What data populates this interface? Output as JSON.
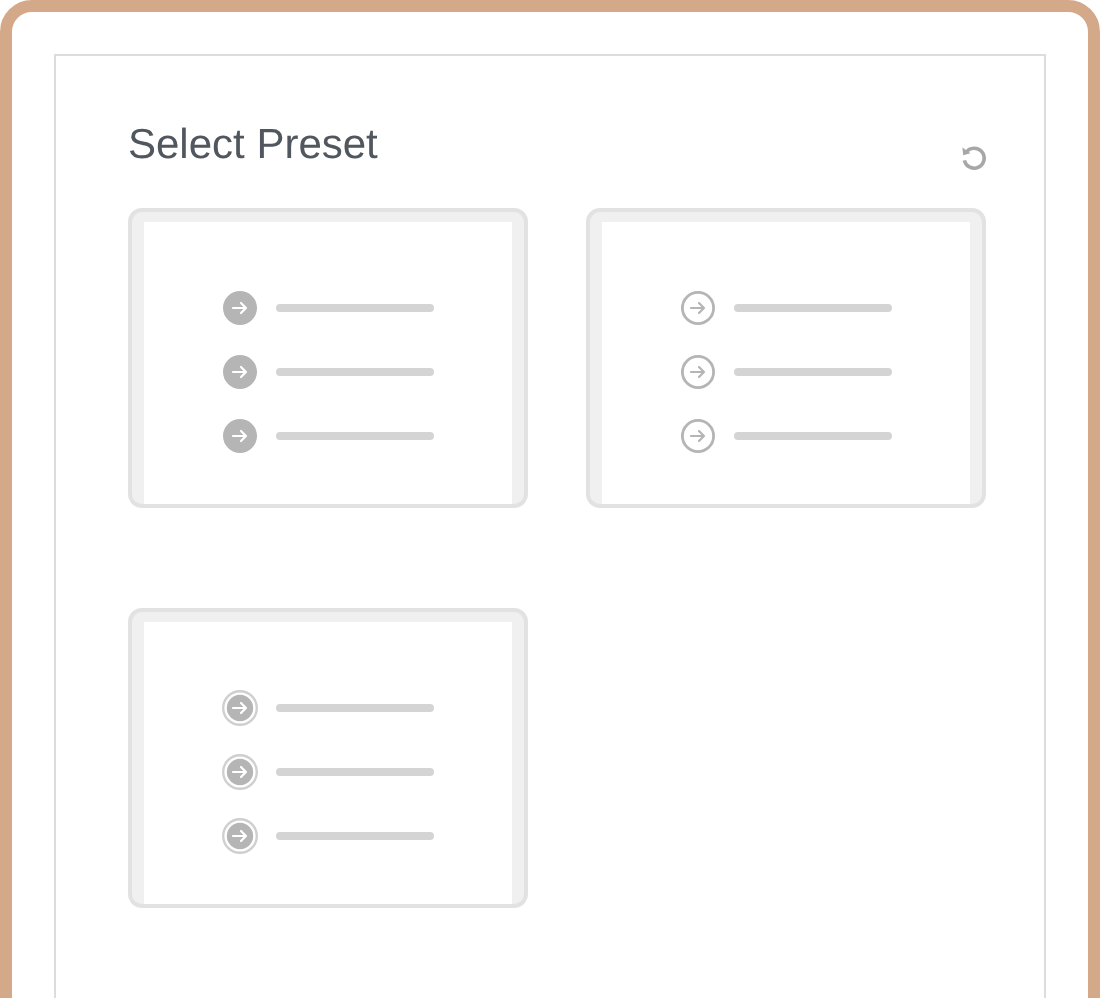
{
  "panel": {
    "title": "Select Preset"
  },
  "presets": [
    {
      "kind": "filled"
    },
    {
      "kind": "outline"
    },
    {
      "kind": "ringed"
    }
  ]
}
